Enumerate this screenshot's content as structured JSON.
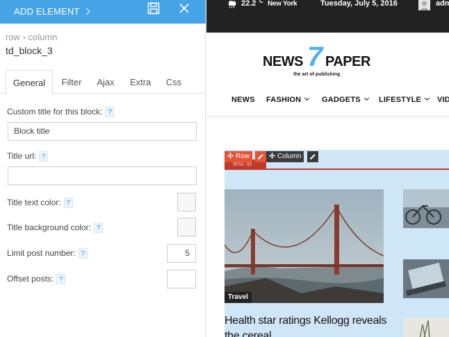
{
  "panel": {
    "add_element_label": "ADD ELEMENT",
    "breadcrumb": {
      "row": "row",
      "sep": "›",
      "column": "column"
    },
    "block_name": "td_block_3",
    "tabs": [
      "General",
      "Filter",
      "Ajax",
      "Extra",
      "Css"
    ],
    "active_tab": "General",
    "fields": {
      "custom_title": {
        "label": "Custom title for this block:",
        "value": "Block title"
      },
      "title_url": {
        "label": "Title url:",
        "value": ""
      },
      "title_text_color": {
        "label": "Title text color:"
      },
      "title_bg_color": {
        "label": "Title background color:"
      },
      "limit_post": {
        "label": "Limit post number:",
        "value": "5"
      },
      "offset_posts": {
        "label": "Offset posts:",
        "value": ""
      }
    },
    "help_glyph": "?"
  },
  "site": {
    "topbar": {
      "temperature": "22.2",
      "unit": "C",
      "city": "New York",
      "date": "Tuesday, July 5, 2016",
      "user": "adm"
    },
    "logo": {
      "news": "NEWS",
      "seven": "7",
      "paper": "PAPER",
      "tagline": "the art of publishing"
    },
    "menu": [
      "NEWS",
      "FASHION",
      "GADGETS",
      "LIFESTYLE",
      "VID"
    ],
    "block": {
      "title_text": "test td",
      "row_label": "Row",
      "column_label": "Column",
      "category": "Travel",
      "headline": "Health star ratings Kellogg reveals the cereal"
    }
  },
  "colors": {
    "accent": "#46a3e6",
    "topbar_bg": "#222222",
    "logo_blue": "#4db2ec",
    "row_badge": "#e35434",
    "block_bg": "#cfe6f7",
    "category_red": "#c0392b"
  }
}
